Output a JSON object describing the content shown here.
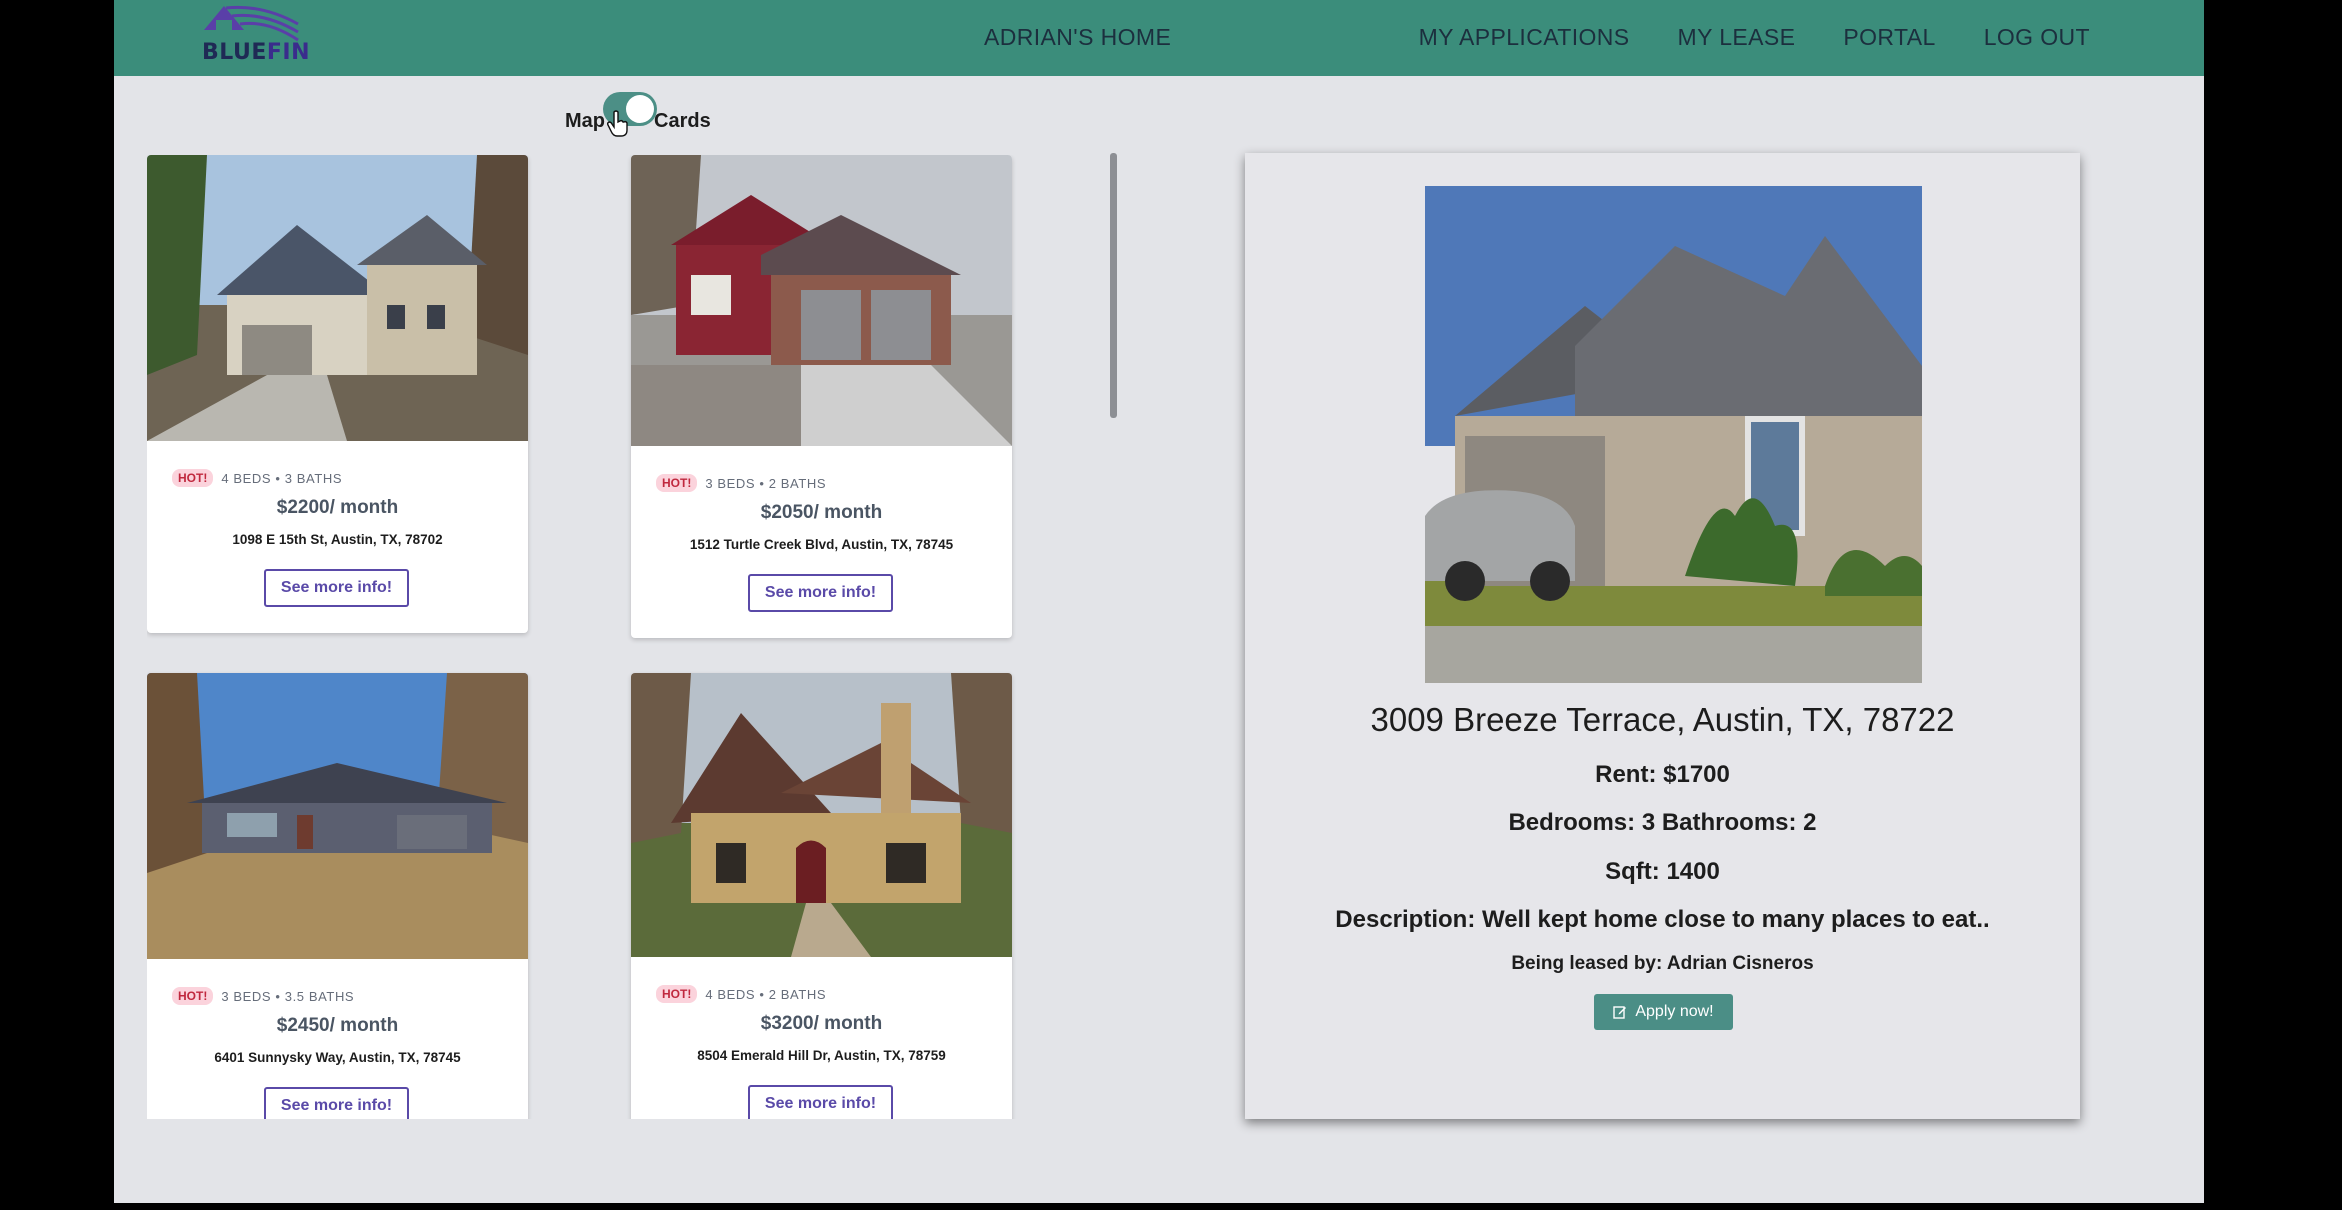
{
  "brand": {
    "logo_text_part1": "BLUE",
    "logo_text_part2": "FIN"
  },
  "nav": {
    "title": "ADRIAN'S HOME",
    "links": [
      "MY APPLICATIONS",
      "MY LEASE",
      "PORTAL",
      "LOG OUT"
    ]
  },
  "view_toggle": {
    "left_label": "Map",
    "right_label": "Cards",
    "selected": "Cards"
  },
  "listings": [
    {
      "badge": "HOT!",
      "beds_baths": "4 BEDS • 3 BATHS",
      "price": "$2200/ month",
      "address": "1098 E 15th St, Austin, TX, 78702",
      "button": "See more info!"
    },
    {
      "badge": "HOT!",
      "beds_baths": "3 BEDS • 2 BATHS",
      "price": "$2050/ month",
      "address": "1512 Turtle Creek Blvd, Austin, TX, 78745",
      "button": "See more info!"
    },
    {
      "badge": "HOT!",
      "beds_baths": "3 BEDS • 3.5 BATHS",
      "price": "$2450/ month",
      "address": "6401 Sunnysky Way, Austin, TX, 78745",
      "button": "See more info!"
    },
    {
      "badge": "HOT!",
      "beds_baths": "4 BEDS • 2 BATHS",
      "price": "$3200/ month",
      "address": "8504 Emerald Hill Dr, Austin, TX, 78759",
      "button": "See more info!"
    }
  ],
  "detail": {
    "address": "3009 Breeze Terrace, Austin, TX, 78722",
    "rent": "Rent: $1700",
    "rooms": "Bedrooms: 3 Bathrooms: 2",
    "sqft": "Sqft: 1400",
    "description": "Description: Well kept home close to many places to eat..",
    "leased_by": "Being leased by: Adrian Cisneros",
    "apply_label": "Apply now!"
  },
  "colors": {
    "navbar": "#3b8d7b",
    "accent_purple": "#5a4aa8",
    "apply_button": "#4b8e86",
    "hot_badge_bg": "#fbd3dc",
    "hot_badge_text": "#c0283e"
  },
  "icons": {
    "apply": "edit-icon",
    "cursor": "hand-pointer-icon"
  }
}
